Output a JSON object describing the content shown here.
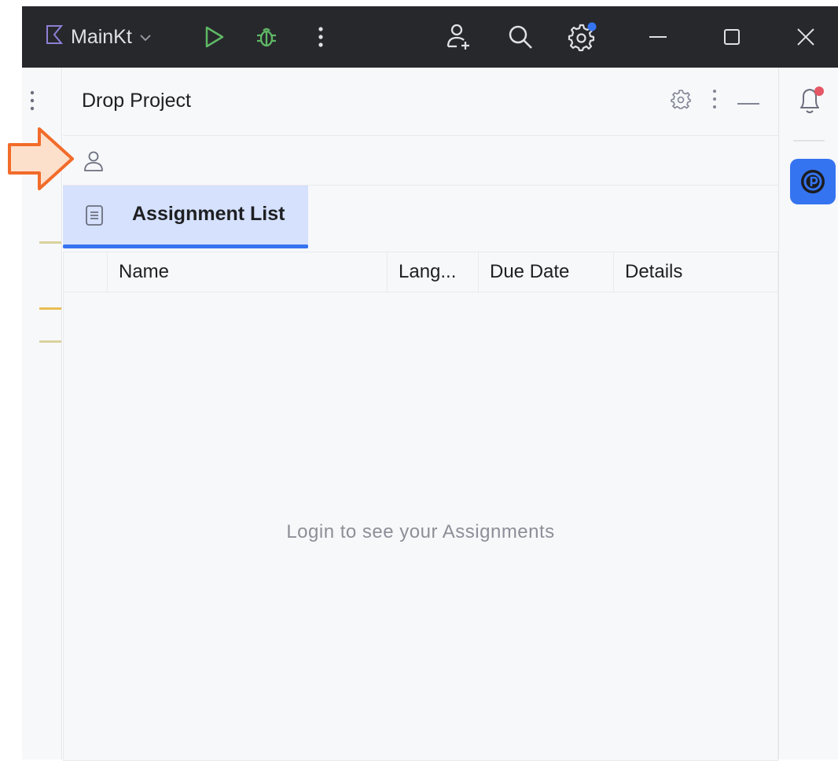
{
  "titlebar": {
    "run_config_label": "MainKt",
    "icons": [
      "kotlin-file-icon",
      "chevron-down-icon",
      "run-icon",
      "debug-icon",
      "more-vertical-icon",
      "add-user-icon",
      "search-icon",
      "settings-icon",
      "minimize-icon",
      "maximize-icon",
      "close-icon"
    ],
    "settings_badge_color": "#3574f0"
  },
  "panel": {
    "title": "Drop Project",
    "header_icons": [
      "gear-icon",
      "more-vertical-icon",
      "minimize-icon"
    ],
    "user_icon": "user-icon",
    "tab": {
      "label": "Assignment List",
      "icon": "list-document-icon"
    },
    "table": {
      "columns": [
        "Name",
        "Lang...",
        "Due Date",
        "Details"
      ],
      "empty_message": "Login to see your Assignments"
    }
  },
  "right_strip": {
    "icons": [
      "notifications-bell-icon",
      "drop-project-icon"
    ],
    "notification_badge_color": "#e55765"
  },
  "annotation": {
    "icon": "arrow-right-icon",
    "color": "#f26b2a"
  },
  "colors": {
    "accent": "#3574f0",
    "tab_selected_bg": "#d5e1fd",
    "titlebar_bg": "#27282c"
  }
}
